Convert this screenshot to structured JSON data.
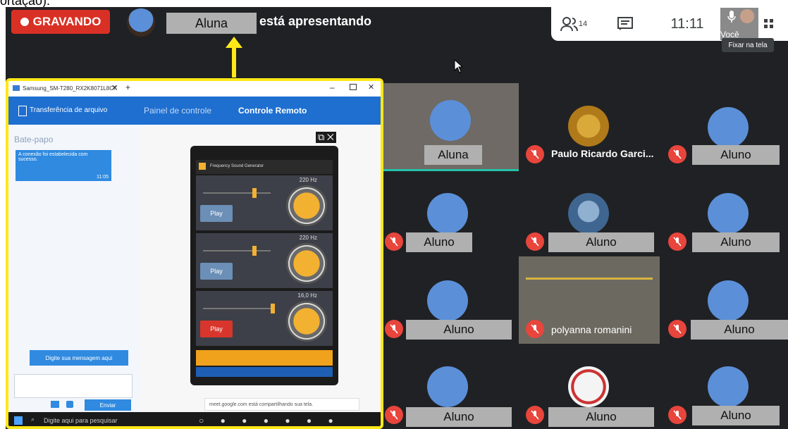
{
  "cut_caption": "ortação).",
  "recording": {
    "label": "GRAVANDO"
  },
  "presenter": {
    "name": "Aluna",
    "suffix": "está apresentando"
  },
  "top_right": {
    "participants_count": "14",
    "time": "11:11",
    "self_label": "Você",
    "pin_tooltip": "Fixar na tela"
  },
  "shared_screen": {
    "window_tab": "Samsung_SM-T280_RX2K8071L8CK",
    "app_title": "Transferência de arquivo",
    "tab_control": "Painel de controle",
    "tab_remote": "Controle Remoto",
    "chat_title": "Bate-papo",
    "chat_message": "A conexão foi estabelecida com sucesso.",
    "chat_time": "11:05",
    "chat_hint": "Digite sua mensagem aqui",
    "send_label": "Enviar",
    "phone_app_title": "Frequency Sound Generator",
    "rows": [
      {
        "hz": "220 Hz",
        "play": "Play",
        "color": "#6b8fb6"
      },
      {
        "hz": "220 Hz",
        "play": "Play",
        "color": "#6b8fb6"
      },
      {
        "hz": "16,0 Hz",
        "play": "Play",
        "color": "#d8362c"
      }
    ],
    "share_notice": "meet.google.com está compartilhando sua tela.",
    "taskbar_search": "Digite aqui para pesquisar"
  },
  "tiles": [
    {
      "name": "Aluna"
    },
    {
      "name": "Paulo Ricardo Garci..."
    },
    {
      "name": "Aluno"
    },
    {
      "name": "Aluno"
    },
    {
      "name": "Aluno"
    },
    {
      "name": "Aluno"
    },
    {
      "name": "Aluno"
    },
    {
      "name": "polyanna romanini"
    },
    {
      "name": "Aluno"
    },
    {
      "name": "Aluno"
    },
    {
      "name": "Aluno"
    },
    {
      "name": "Aluno"
    }
  ],
  "colors": {
    "recording": "#d93025",
    "share_border": "#ffe817",
    "meet_bg": "#202124",
    "mic_off": "#e8453c"
  }
}
